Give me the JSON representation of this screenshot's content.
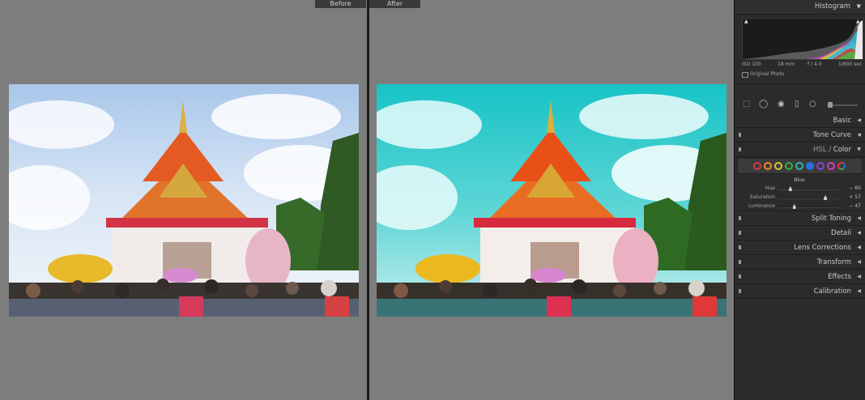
{
  "compare": {
    "before_label": "Before",
    "after_label": "After"
  },
  "panel": {
    "histogram_title": "Histogram",
    "iso": "ISO 100",
    "focal": "18 mm",
    "aperture": "f / 4.0",
    "shutter": "1/800 sec",
    "original_photo": "Original Photo",
    "sections": {
      "basic": "Basic",
      "tone_curve": "Tone Curve",
      "hsl_part1": "HSL",
      "hsl_sep": "/",
      "hsl_part2": "Color",
      "split_toning": "Split Toning",
      "detail": "Detail",
      "lens_corrections": "Lens Corrections",
      "transform": "Transform",
      "effects": "Effects",
      "calibration": "Calibration"
    },
    "color_swatches": [
      {
        "name": "red",
        "color": "#d63a3a"
      },
      {
        "name": "orange",
        "color": "#e88b2b"
      },
      {
        "name": "yellow",
        "color": "#d8c52c"
      },
      {
        "name": "green",
        "color": "#3fb040"
      },
      {
        "name": "aqua",
        "color": "#2bb7b0"
      },
      {
        "name": "blue",
        "color": "#2c6ee0",
        "selected": true
      },
      {
        "name": "purple",
        "color": "#8e3ed6"
      },
      {
        "name": "magenta",
        "color": "#d13fb4"
      }
    ],
    "hsl": {
      "active_color": "Blue",
      "hue_label": "Hue",
      "hue_value": "− 60",
      "hue": -60,
      "sat_label": "Saturation",
      "sat_value": "+ 57",
      "saturation": 57,
      "lum_label": "Luminance",
      "lum_value": "− 47",
      "luminance": -47
    }
  }
}
